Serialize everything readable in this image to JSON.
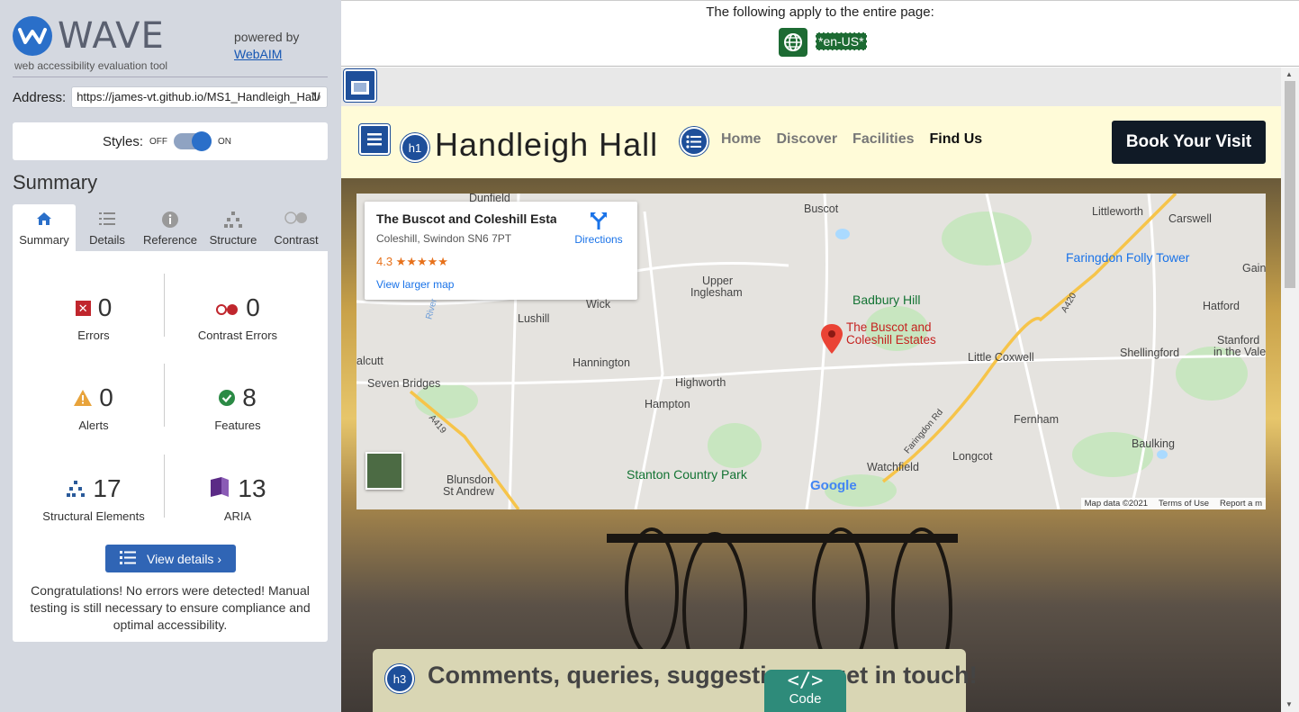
{
  "wave": {
    "logo_text": "WAVE",
    "logo_subtitle": "web accessibility evaluation tool",
    "powered_by": "powered by",
    "webaim_link": "WebAIM",
    "address_label": "Address:",
    "address_value": "https://james-vt.github.io/MS1_Handleigh_Hall/",
    "styles_label": "Styles:",
    "styles_off": "OFF",
    "styles_on": "ON",
    "summary_title": "Summary",
    "tabs": [
      {
        "label": "Summary",
        "icon": "home-icon"
      },
      {
        "label": "Details",
        "icon": "list-icon"
      },
      {
        "label": "Reference",
        "icon": "info-icon"
      },
      {
        "label": "Structure",
        "icon": "hierarchy-icon"
      },
      {
        "label": "Contrast",
        "icon": "contrast-icon"
      }
    ],
    "stats": {
      "errors": {
        "value": "0",
        "label": "Errors"
      },
      "contrast_errors": {
        "value": "0",
        "label": "Contrast Errors"
      },
      "alerts": {
        "value": "0",
        "label": "Alerts"
      },
      "features": {
        "value": "8",
        "label": "Features"
      },
      "structural": {
        "value": "17",
        "label": "Structural Elements"
      },
      "aria": {
        "value": "13",
        "label": "ARIA"
      }
    },
    "view_details": "View details ›",
    "congrats": "Congratulations! No errors were detected! Manual testing is still necessary to ensure compliance and optimal accessibility."
  },
  "topbar": {
    "text": "The following apply to the entire page:",
    "lang": "*en-US*"
  },
  "site": {
    "h1_badge": "h1",
    "title": "Handleigh Hall",
    "nav": [
      "Home",
      "Discover",
      "Facilities",
      "Find Us"
    ],
    "book_button": "Book Your Visit",
    "h3_badge": "h3",
    "contact_title": "Comments, queries, suggestions - get in touch!",
    "code_symbol": "</>",
    "code_label": "Code"
  },
  "map": {
    "card_title": "The Buscot and Coleshill Esta...",
    "card_address": "Coleshill, Swindon SN6 7PT",
    "card_rating": "4.3 ★★★★★",
    "card_link": "View larger map",
    "directions": "Directions",
    "places": {
      "dunfield": "Dunfield",
      "buscot": "Buscot",
      "littleworth": "Littleworth",
      "carswell": "Carswell",
      "gain": "Gain",
      "faringdon_folly": "Faringdon Folly Tower",
      "upper_inglesham_1": "Upper",
      "upper_inglesham_2": "Inglesham",
      "badbury": "Badbury Hill",
      "hatford": "Hatford",
      "wick": "Wick",
      "lushill": "Lushill",
      "estate_1": "The Buscot and",
      "estate_2": "Coleshill Estates",
      "stanford_1": "Stanford",
      "stanford_2": "in the Vale",
      "alcutt": "alcutt",
      "hannington": "Hannington",
      "little_coxwell": "Little Coxwell",
      "shellingford": "Shellingford",
      "seven_bridges": "Seven Bridges",
      "highworth": "Highworth",
      "hampton": "Hampton",
      "fernham": "Fernham",
      "baulking": "Baulking",
      "longcot": "Longcot",
      "watchfield": "Watchfield",
      "stanton": "Stanton Country Park",
      "blunsdon_1": "Blunsdon",
      "blunsdon_2": "St Andrew",
      "river": "River",
      "a419": "A419",
      "a420": "A420",
      "faringdon_rd": "Faringdon Rd"
    },
    "google": "Google",
    "footer": [
      "Map data ©2021",
      "Terms of Use",
      "Report a m"
    ]
  },
  "colors": {
    "wave_blue": "#2a6fc9",
    "error_red": "#c0262d",
    "alert_orange": "#e8a33b",
    "feature_green": "#2b8a45",
    "aria_purple": "#5b2a86",
    "header_bg": "#fffbd8",
    "book_bg": "#101a26"
  }
}
